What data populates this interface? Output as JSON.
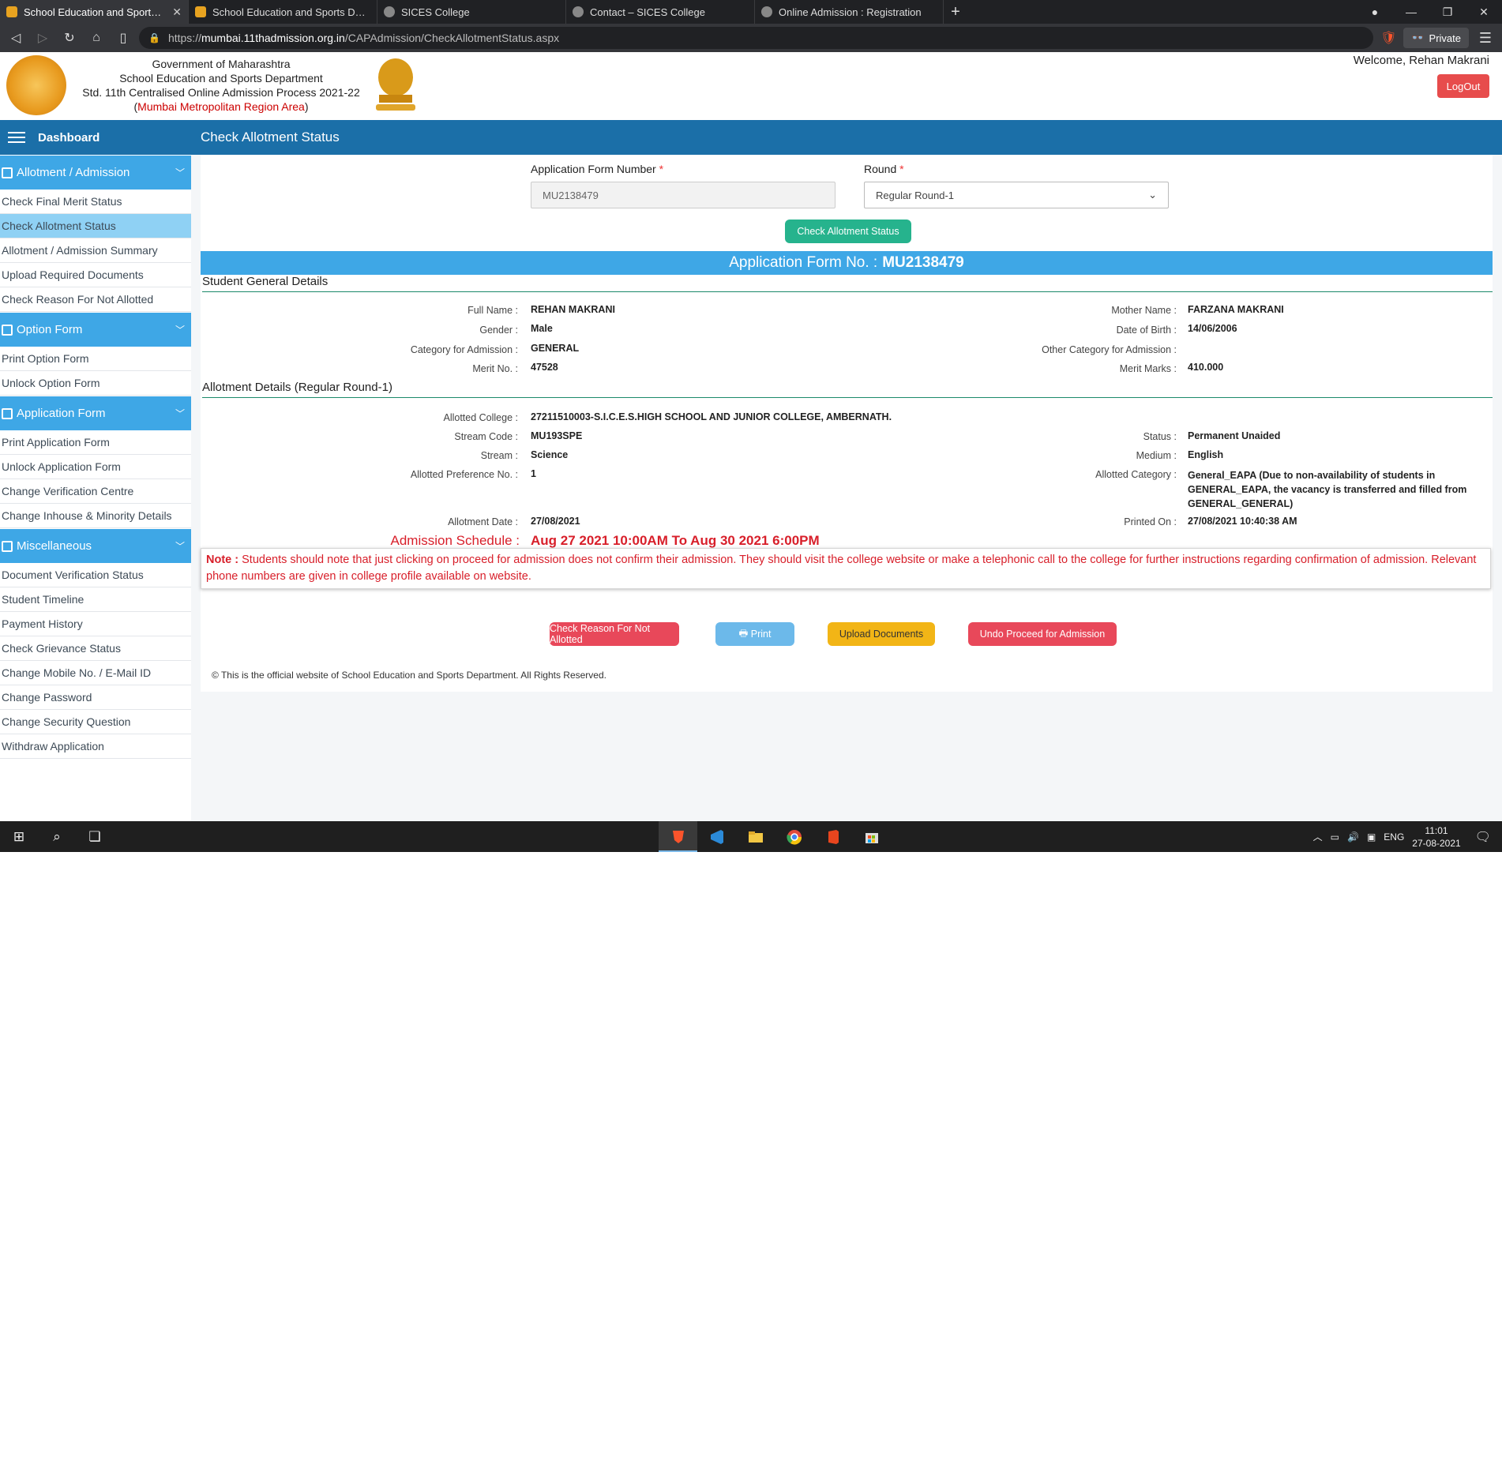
{
  "browser": {
    "tabs": [
      {
        "label": "School Education and Sports Dep",
        "active": true,
        "icon": "government-favicon-icon"
      },
      {
        "label": "School Education and Sports Departm",
        "active": false,
        "icon": "government-favicon-icon"
      },
      {
        "label": "SICES College",
        "active": false,
        "icon": "globe-icon"
      },
      {
        "label": "Contact – SICES College",
        "active": false,
        "icon": "globe-icon"
      },
      {
        "label": "Online Admission : Registration",
        "active": false,
        "icon": "globe-icon"
      }
    ],
    "url_scheme": "https://",
    "url_host": "mumbai.11thadmission.org.in",
    "url_path": "/CAPAdmission/CheckAllotmentStatus.aspx",
    "private_label": "Private"
  },
  "header": {
    "line1": "Government of Maharashtra",
    "line2": "School Education and Sports Department",
    "line3": "Std. 11th Centralised Online Admission Process 2021-22",
    "region_open": "(",
    "region": "Mumbai Metropolitan Region Area",
    "region_close": ")",
    "welcome_prefix": "Welcome, ",
    "welcome_name": "Rehan Makrani",
    "logout": "LogOut"
  },
  "sidebar": {
    "dashboard": "Dashboard",
    "sections": [
      {
        "title": "Allotment / Admission",
        "items": [
          "Check Final Merit Status",
          "Check Allotment Status",
          "Allotment / Admission Summary",
          "Upload Required Documents",
          "Check Reason For Not Allotted"
        ]
      },
      {
        "title": "Option Form",
        "items": [
          "Print Option Form",
          "Unlock Option Form"
        ]
      },
      {
        "title": "Application Form",
        "items": [
          "Print Application Form",
          "Unlock Application Form",
          "Change Verification Centre",
          "Change Inhouse & Minority Details"
        ]
      },
      {
        "title": "Miscellaneous",
        "items": [
          "Document Verification Status",
          "Student Timeline",
          "Payment History",
          "Check Grievance Status",
          "Change Mobile No. / E-Mail ID",
          "Change Password",
          "Change Security Question",
          "Withdraw Application"
        ]
      }
    ]
  },
  "page": {
    "title": "Check Allotment Status",
    "form": {
      "app_no_label": "Application Form Number",
      "app_no_value": "MU2138479",
      "round_label": "Round",
      "round_value": "Regular Round-1",
      "required_mark": "*",
      "check_button": "Check Allotment Status"
    },
    "app_banner_label": "Application Form No. :",
    "app_banner_value": "MU2138479",
    "general_title": "Student General Details",
    "general": {
      "full_name_label": "Full Name :",
      "full_name": "REHAN MAKRANI",
      "gender_label": "Gender :",
      "gender": "Male",
      "category_label": "Category for Admission :",
      "category": "GENERAL",
      "merit_no_label": "Merit No. :",
      "merit_no": "47528",
      "mother_label": "Mother Name :",
      "mother": "FARZANA MAKRANI",
      "dob_label": "Date of Birth :",
      "dob": "14/06/2006",
      "other_cat_label": "Other Category for Admission :",
      "other_cat": "",
      "merit_marks_label": "Merit Marks :",
      "merit_marks": "410.000"
    },
    "allotment_title": "Allotment Details (Regular Round-1)",
    "allotment": {
      "college_label": "Allotted College :",
      "college": "27211510003-S.I.C.E.S.HIGH SCHOOL AND JUNIOR COLLEGE, AMBERNATH.",
      "stream_code_label": "Stream Code :",
      "stream_code": "MU193SPE",
      "stream_label": "Stream :",
      "stream": "Science",
      "pref_label": "Allotted Preference No. :",
      "pref": "1",
      "date_label": "Allotment Date :",
      "date": "27/08/2021",
      "status_label": "Status :",
      "status": "Permanent Unaided",
      "medium_label": "Medium :",
      "medium": "English",
      "alloted_cat_label": "Allotted Category :",
      "alloted_cat_1": "General_EAPA (Due to non-availability of students in",
      "alloted_cat_2": "GENERAL_EAPA, the vacancy is transferred and filled from",
      "alloted_cat_3": "GENERAL_GENERAL)",
      "printed_label": "Printed On :",
      "printed": "27/08/2021 10:40:38 AM"
    },
    "schedule_label": "Admission Schedule :",
    "schedule_value": "Aug 27 2021 10:00AM To Aug 30 2021 6:00PM",
    "note_label": "Note :",
    "note_text": " Students should note that just clicking on proceed for admission does not confirm their admission. They should visit the college website or make a telephonic call to the college for further instructions regarding confirmation of admission. Relevant phone numbers are given in college profile available on website.",
    "buttons": {
      "not_allotted": "Check Reason For Not Allotted",
      "print": "Print",
      "upload": "Upload Documents",
      "undo": "Undo Proceed for Admission"
    },
    "footer": "© This is the official website of School Education and Sports Department. All Rights Reserved."
  },
  "taskbar": {
    "lang": "ENG",
    "time": "11:01",
    "date": "27-08-2021"
  }
}
